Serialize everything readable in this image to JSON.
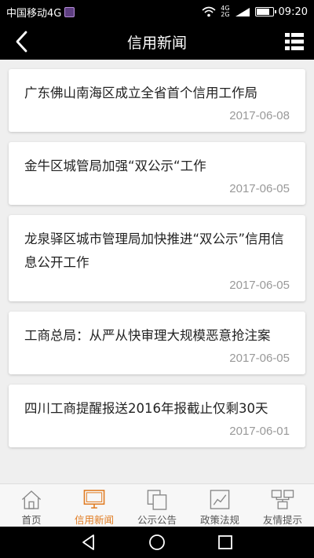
{
  "status_bar": {
    "carrier": "中国移动4G",
    "network_small": "4G",
    "network_small2": "2G",
    "battery_level": 0.85,
    "time": "09:20"
  },
  "header": {
    "title": "信用新闻",
    "back_icon": "chevron-left-icon",
    "menu_icon": "list-menu-icon"
  },
  "news": [
    {
      "headline": "广东佛山南海区成立全省首个信用工作局",
      "date": "2017-06-08"
    },
    {
      "headline": "金牛区城管局加强“双公示“工作",
      "date": "2017-06-05"
    },
    {
      "headline": "龙泉驿区城市管理局加快推进“双公示”信用信息公开工作",
      "date": "2017-06-05"
    },
    {
      "headline": "工商总局：从严从快审理大规模恶意抢注案",
      "date": "2017-06-05"
    },
    {
      "headline": "四川工商提醒报送2016年报截止仅剩30天",
      "date": "2017-06-01"
    }
  ],
  "tabs": [
    {
      "label": "首页",
      "icon": "home-icon",
      "active": false
    },
    {
      "label": "信用新闻",
      "icon": "monitor-icon",
      "active": true
    },
    {
      "label": "公示公告",
      "icon": "copy-icon",
      "active": false
    },
    {
      "label": "政策法规",
      "icon": "chart-icon",
      "active": false
    },
    {
      "label": "友情提示",
      "icon": "network-icon",
      "active": false
    }
  ],
  "colors": {
    "accent": "#e07a1f",
    "header_bg": "#000000",
    "page_bg": "#efefef"
  }
}
